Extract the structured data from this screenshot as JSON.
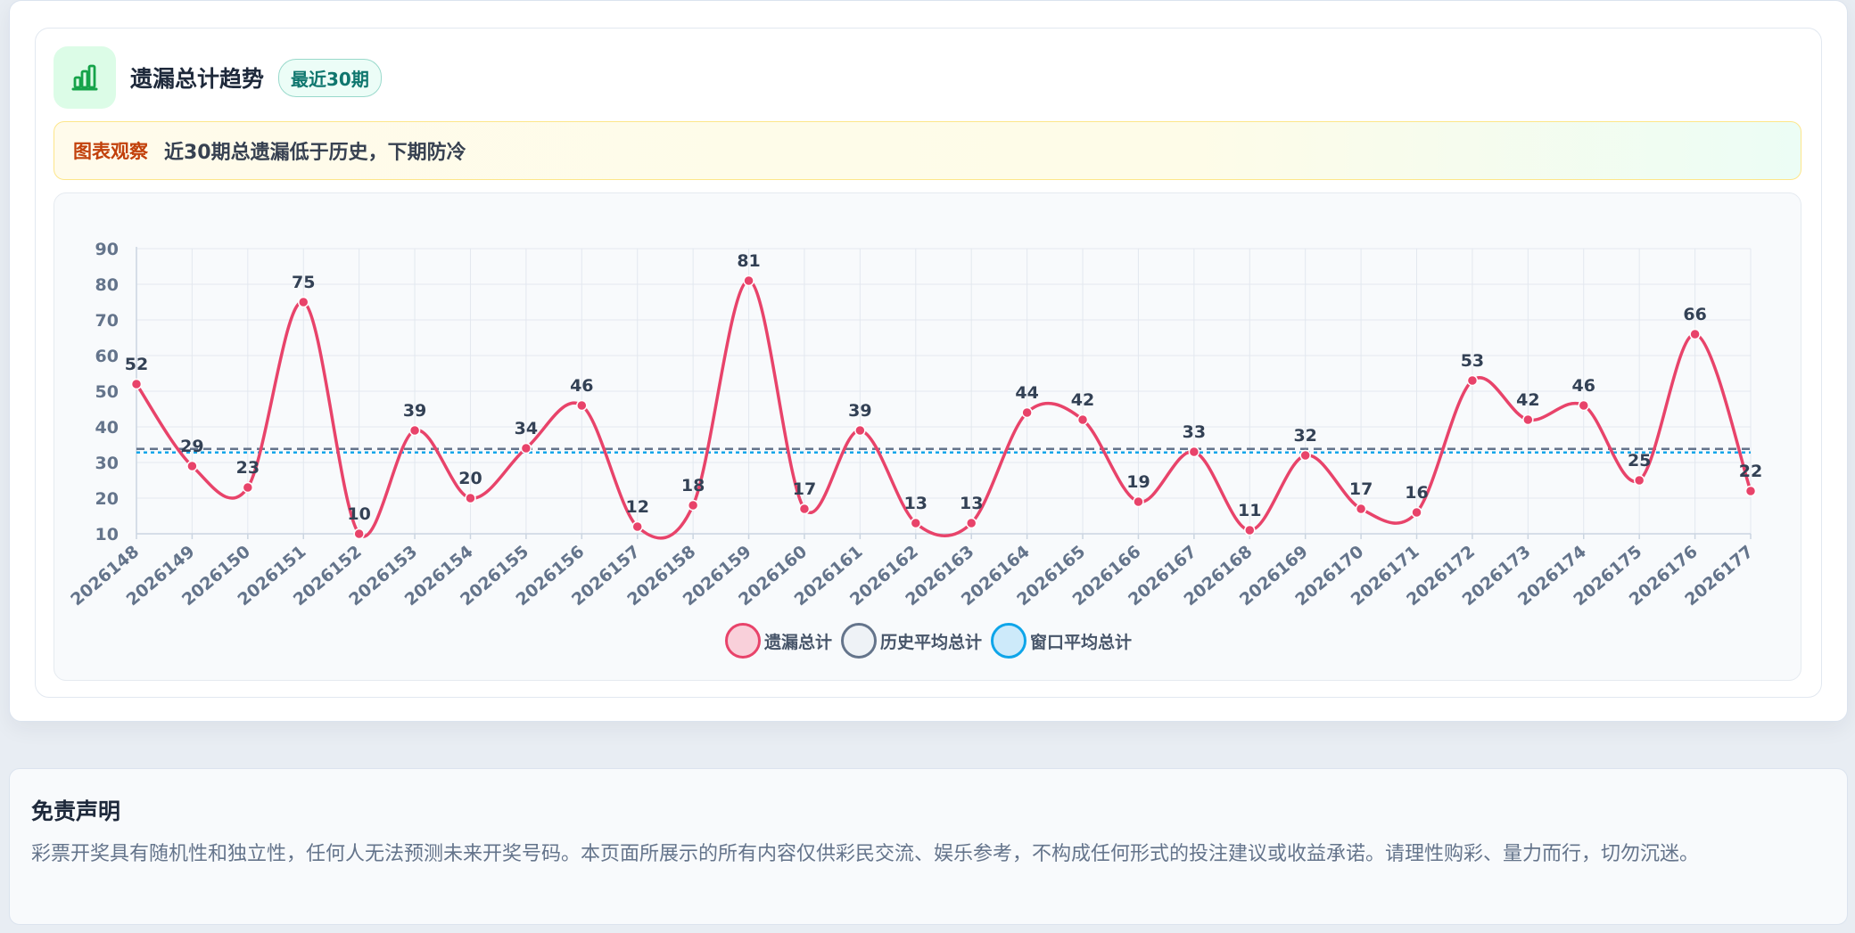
{
  "header": {
    "title": "遗漏总计趋势",
    "badge": "最近30期",
    "icon": "bar-chart-icon"
  },
  "observation": {
    "label": "图表观察",
    "text": "近30期总遗漏低于历史，下期防冷"
  },
  "chart_data": {
    "type": "line",
    "x": [
      "2026148",
      "2026149",
      "2026150",
      "2026151",
      "2026152",
      "2026153",
      "2026154",
      "2026155",
      "2026156",
      "2026157",
      "2026158",
      "2026159",
      "2026160",
      "2026161",
      "2026162",
      "2026163",
      "2026164",
      "2026165",
      "2026166",
      "2026167",
      "2026168",
      "2026169",
      "2026170",
      "2026171",
      "2026172",
      "2026173",
      "2026174",
      "2026175",
      "2026176",
      "2026177"
    ],
    "series": [
      {
        "name": "遗漏总计",
        "values": [
          52,
          29,
          23,
          75,
          10,
          39,
          20,
          34,
          46,
          12,
          18,
          81,
          17,
          39,
          13,
          13,
          44,
          42,
          19,
          33,
          11,
          32,
          17,
          16,
          53,
          42,
          46,
          25,
          66,
          22
        ],
        "color": "#e8436a",
        "style": "smooth",
        "data_labels": true
      },
      {
        "name": "历史平均总计",
        "constant": 33.8,
        "color": "#64748b",
        "style": "dashed"
      },
      {
        "name": "窗口平均总计",
        "constant": 32.8,
        "color": "#0ea5e9",
        "style": "dotted"
      }
    ],
    "yticks": [
      10,
      20,
      30,
      40,
      50,
      60,
      70,
      80,
      90
    ],
    "ylim": [
      10,
      90
    ],
    "grid": true,
    "legend_position": "bottom-center",
    "xlabel": "",
    "ylabel": ""
  },
  "legend": [
    {
      "label": "遗漏总计",
      "fill": "#f9d0da",
      "stroke": "#e8436a"
    },
    {
      "label": "历史平均总计",
      "fill": "#eef2f6",
      "stroke": "#64748b"
    },
    {
      "label": "窗口平均总计",
      "fill": "#cdeafa",
      "stroke": "#0ea5e9"
    }
  ],
  "disclaimer": {
    "title": "免责声明",
    "text": "彩票开奖具有随机性和独立性，任何人无法预测未来开奖号码。本页面所展示的所有内容仅供彩民交流、娱乐参考，不构成任何形式的投注建议或收益承诺。请理性购彩、量力而行，切勿沉迷。"
  }
}
